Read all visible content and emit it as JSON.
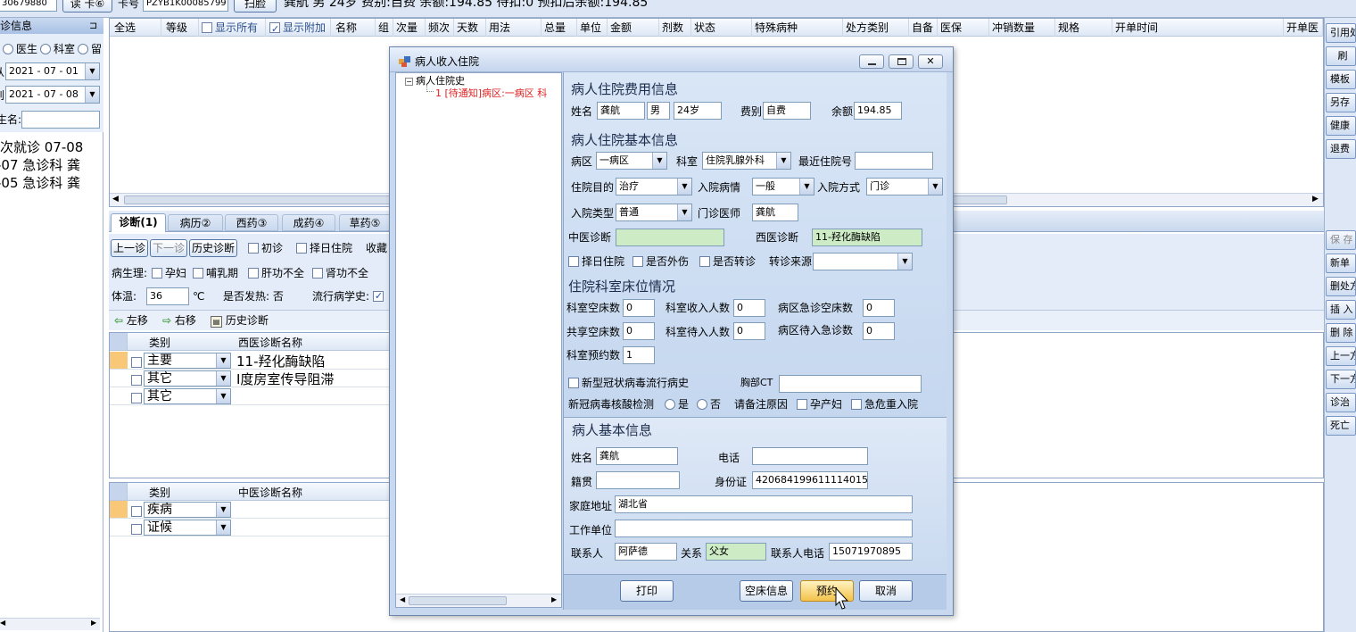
{
  "topbar": {
    "code_value": "30679880",
    "read_card_label": "读 卡⑥",
    "card_no_label": "卡号",
    "card_no_value": "PZYB1K00085799",
    "scan_label": "扫脸",
    "patient_summary": "龚航 男 24岁 费别:自费 余额:194.85 待扣:0 预扣后余额:194.85"
  },
  "left_panel": {
    "title": "诊信息",
    "pin": "⊐",
    "radio_labels": [
      "医生",
      "科室",
      "留"
    ],
    "date_from_label": "从",
    "date_from": "2021 - 07 - 01",
    "date_to_label": "到",
    "date_to": "2021 - 07 - 08",
    "name_label": "生名:",
    "visits": [
      "次就诊 07-08",
      "-07 急诊科 龚",
      "-05 急诊科 龚"
    ]
  },
  "rx_header": {
    "columns": [
      "全选",
      "等级",
      "显示所有",
      "显示附加",
      "名称",
      "组",
      "次量",
      "频次",
      "天数",
      "用法",
      "总量",
      "单位",
      "金额",
      "剂数",
      "状态",
      "特殊病种",
      "处方类别",
      "自备",
      "医保",
      "冲销数量",
      "规格",
      "开单时间",
      "开单医"
    ]
  },
  "tabs": [
    "诊断(1)",
    "病历②",
    "西药③",
    "成药④",
    "草药⑤"
  ],
  "diag_toolbar": {
    "prev": "上一诊",
    "next": "下一诊",
    "history": "历史诊断",
    "first_visit": "初诊",
    "choose_day": "择日住院",
    "collect": "收藏",
    "physio_label": "病生理:",
    "physio_items": [
      "孕妇",
      "哺乳期",
      "肝功不全",
      "肾功不全"
    ],
    "temp_label": "体温:",
    "temp_value": "36",
    "temp_unit": "℃",
    "fever": "是否发热: 否",
    "epi": "流行病学史:"
  },
  "move_toolbar": {
    "left": "左移",
    "right": "右移",
    "history": "历史诊断"
  },
  "western_table": {
    "col_type": "类别",
    "col_name": "西医诊断名称",
    "rows": [
      {
        "type": "主要",
        "name": "11-羟化酶缺陷"
      },
      {
        "type": "其它",
        "name": "Ⅰ度房室传导阻滞"
      },
      {
        "type": "其它",
        "name": ""
      }
    ]
  },
  "tcm_table": {
    "col_type": "类别",
    "col_name": "中医诊断名称",
    "rows": [
      {
        "type": "疾病"
      },
      {
        "type": "证候"
      }
    ]
  },
  "right_toolbar": [
    "引用处",
    "刷",
    "模板",
    "另存",
    "健康",
    "退费",
    "保 存",
    "新单",
    "删处方",
    "插 入",
    "删 除",
    "上一方",
    "下一方",
    "诊治",
    "死亡"
  ],
  "dialog": {
    "title": "病人收入住院",
    "tree_root": "病人住院史",
    "tree_item": "1 [待通知]病区:一病区 科",
    "fee": {
      "title": "病人住院费用信息",
      "name_label": "姓名",
      "name": "龚航",
      "sex": "男",
      "age": "24岁",
      "fee_type_label": "费别",
      "fee_type": "自费",
      "balance_label": "余额",
      "balance": "194.85"
    },
    "basic": {
      "title": "病人住院基本信息",
      "ward_label": "病区",
      "ward": "一病区",
      "dept_label": "科室",
      "dept": "住院乳腺外科",
      "recent_no_label": "最近住院号",
      "recent_no": "",
      "purpose_label": "住院目的",
      "purpose": "治疗",
      "condition_label": "入院病情",
      "condition": "一般",
      "way_label": "入院方式",
      "way": "门诊",
      "type_label": "入院类型",
      "type": "普通",
      "doctor_label": "门诊医师",
      "doctor": "龚航",
      "tcm_diag_label": "中医诊断",
      "tcm_diag": "",
      "west_diag_label": "西医诊断",
      "west_diag": "11-羟化酶缺陷",
      "choose_day": "择日住院",
      "outside_injury": "是否外伤",
      "transfer": "是否转诊",
      "transfer_source_label": "转诊来源",
      "transfer_source": ""
    },
    "beds": {
      "title": "住院科室床位情况",
      "dept_empty_label": "科室空床数",
      "dept_empty": "0",
      "dept_admit_label": "科室收入人数",
      "dept_admit": "0",
      "ward_er_empty_label": "病区急诊空床数",
      "ward_er_empty": "0",
      "shared_empty_label": "共享空床数",
      "shared_empty": "0",
      "dept_wait_label": "科室待入人数",
      "dept_wait": "0",
      "ward_wait_er_label": "病区待入急诊数",
      "ward_wait_er": "0",
      "dept_reserve_label": "科室预约数",
      "dept_reserve": "1",
      "covid_history": "新型冠状病毒流行病史",
      "chest_ct_label": "胸部CT",
      "chest_ct": "",
      "covid_test_label": "新冠病毒核酸检测",
      "yes": "是",
      "no": "否",
      "note_label": "请备注原因",
      "pregnant": "孕产妇",
      "critical_readmit": "急危重入院"
    },
    "patient": {
      "title": "病人基本信息",
      "name_label": "姓名",
      "name": "龚航",
      "phone_label": "电话",
      "phone": "",
      "native_label": "籍贯",
      "native": "",
      "id_label": "身份证",
      "id": "420684199611114015",
      "address_label": "家庭地址",
      "address": "湖北省",
      "work_label": "工作单位",
      "work": "",
      "contact_label": "联系人",
      "contact": "阿萨德",
      "relation_label": "关系",
      "relation": "父女",
      "contact_phone_label": "联系人电话",
      "contact_phone": "15071970895"
    },
    "buttons": {
      "print": "打印",
      "empty_bed": "空床信息",
      "reserve": "预约",
      "cancel": "取消"
    }
  }
}
